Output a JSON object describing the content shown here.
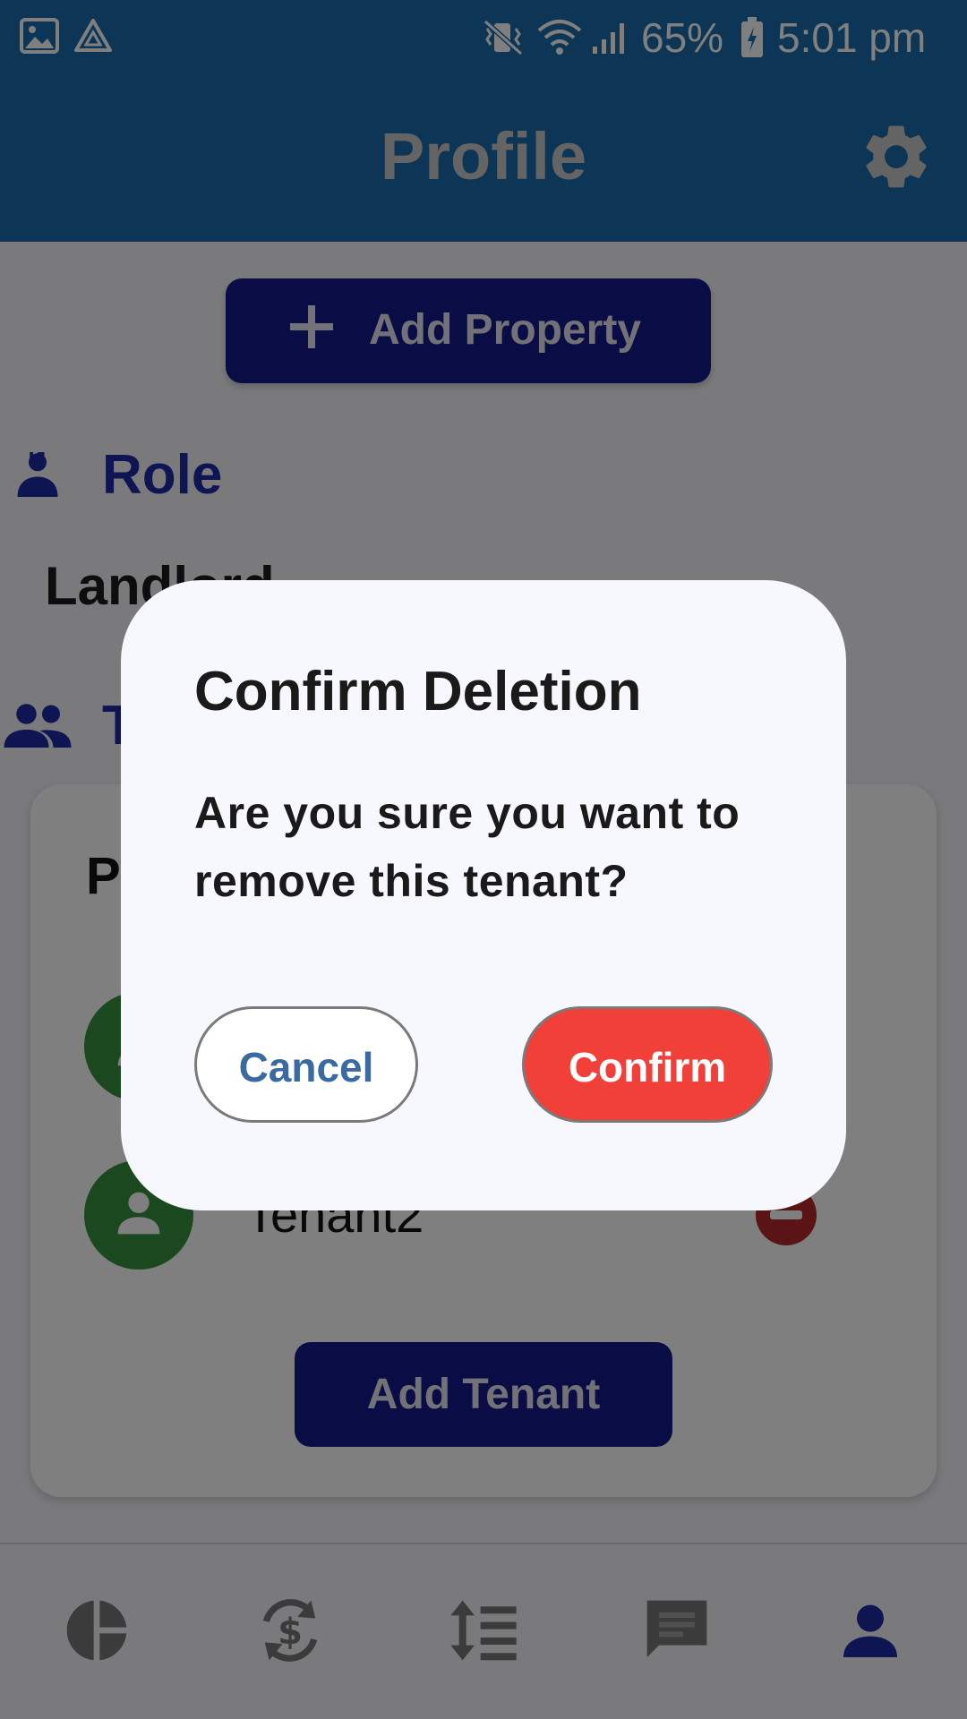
{
  "status_bar": {
    "battery": "65%",
    "time": "5:01 pm"
  },
  "header": {
    "title": "Profile"
  },
  "main": {
    "add_property_label": "Add Property",
    "role_section_title": "Role",
    "role_value": "Landlord",
    "tenants_section_title": "T",
    "card_heading": "P",
    "tenants": [
      {
        "name": ""
      },
      {
        "name": "Tenant2"
      }
    ],
    "add_tenant_label": "Add Tenant"
  },
  "bottom_nav": {
    "items": [
      {
        "icon": "pie-chart-icon"
      },
      {
        "icon": "currency-exchange-icon"
      },
      {
        "icon": "sort-list-icon"
      },
      {
        "icon": "chat-icon"
      },
      {
        "icon": "person-icon",
        "active": true
      }
    ]
  },
  "dialog": {
    "title": "Confirm Deletion",
    "message": "Are you sure you want to remove this tenant?",
    "cancel_label": "Cancel",
    "confirm_label": "Confirm"
  },
  "colors": {
    "app_bar": "#1a6aab",
    "primary_button": "#141a8a",
    "accent_text": "#1d2ba4",
    "avatar": "#38913e",
    "remove": "#b4282a",
    "confirm": "#f1403a"
  }
}
